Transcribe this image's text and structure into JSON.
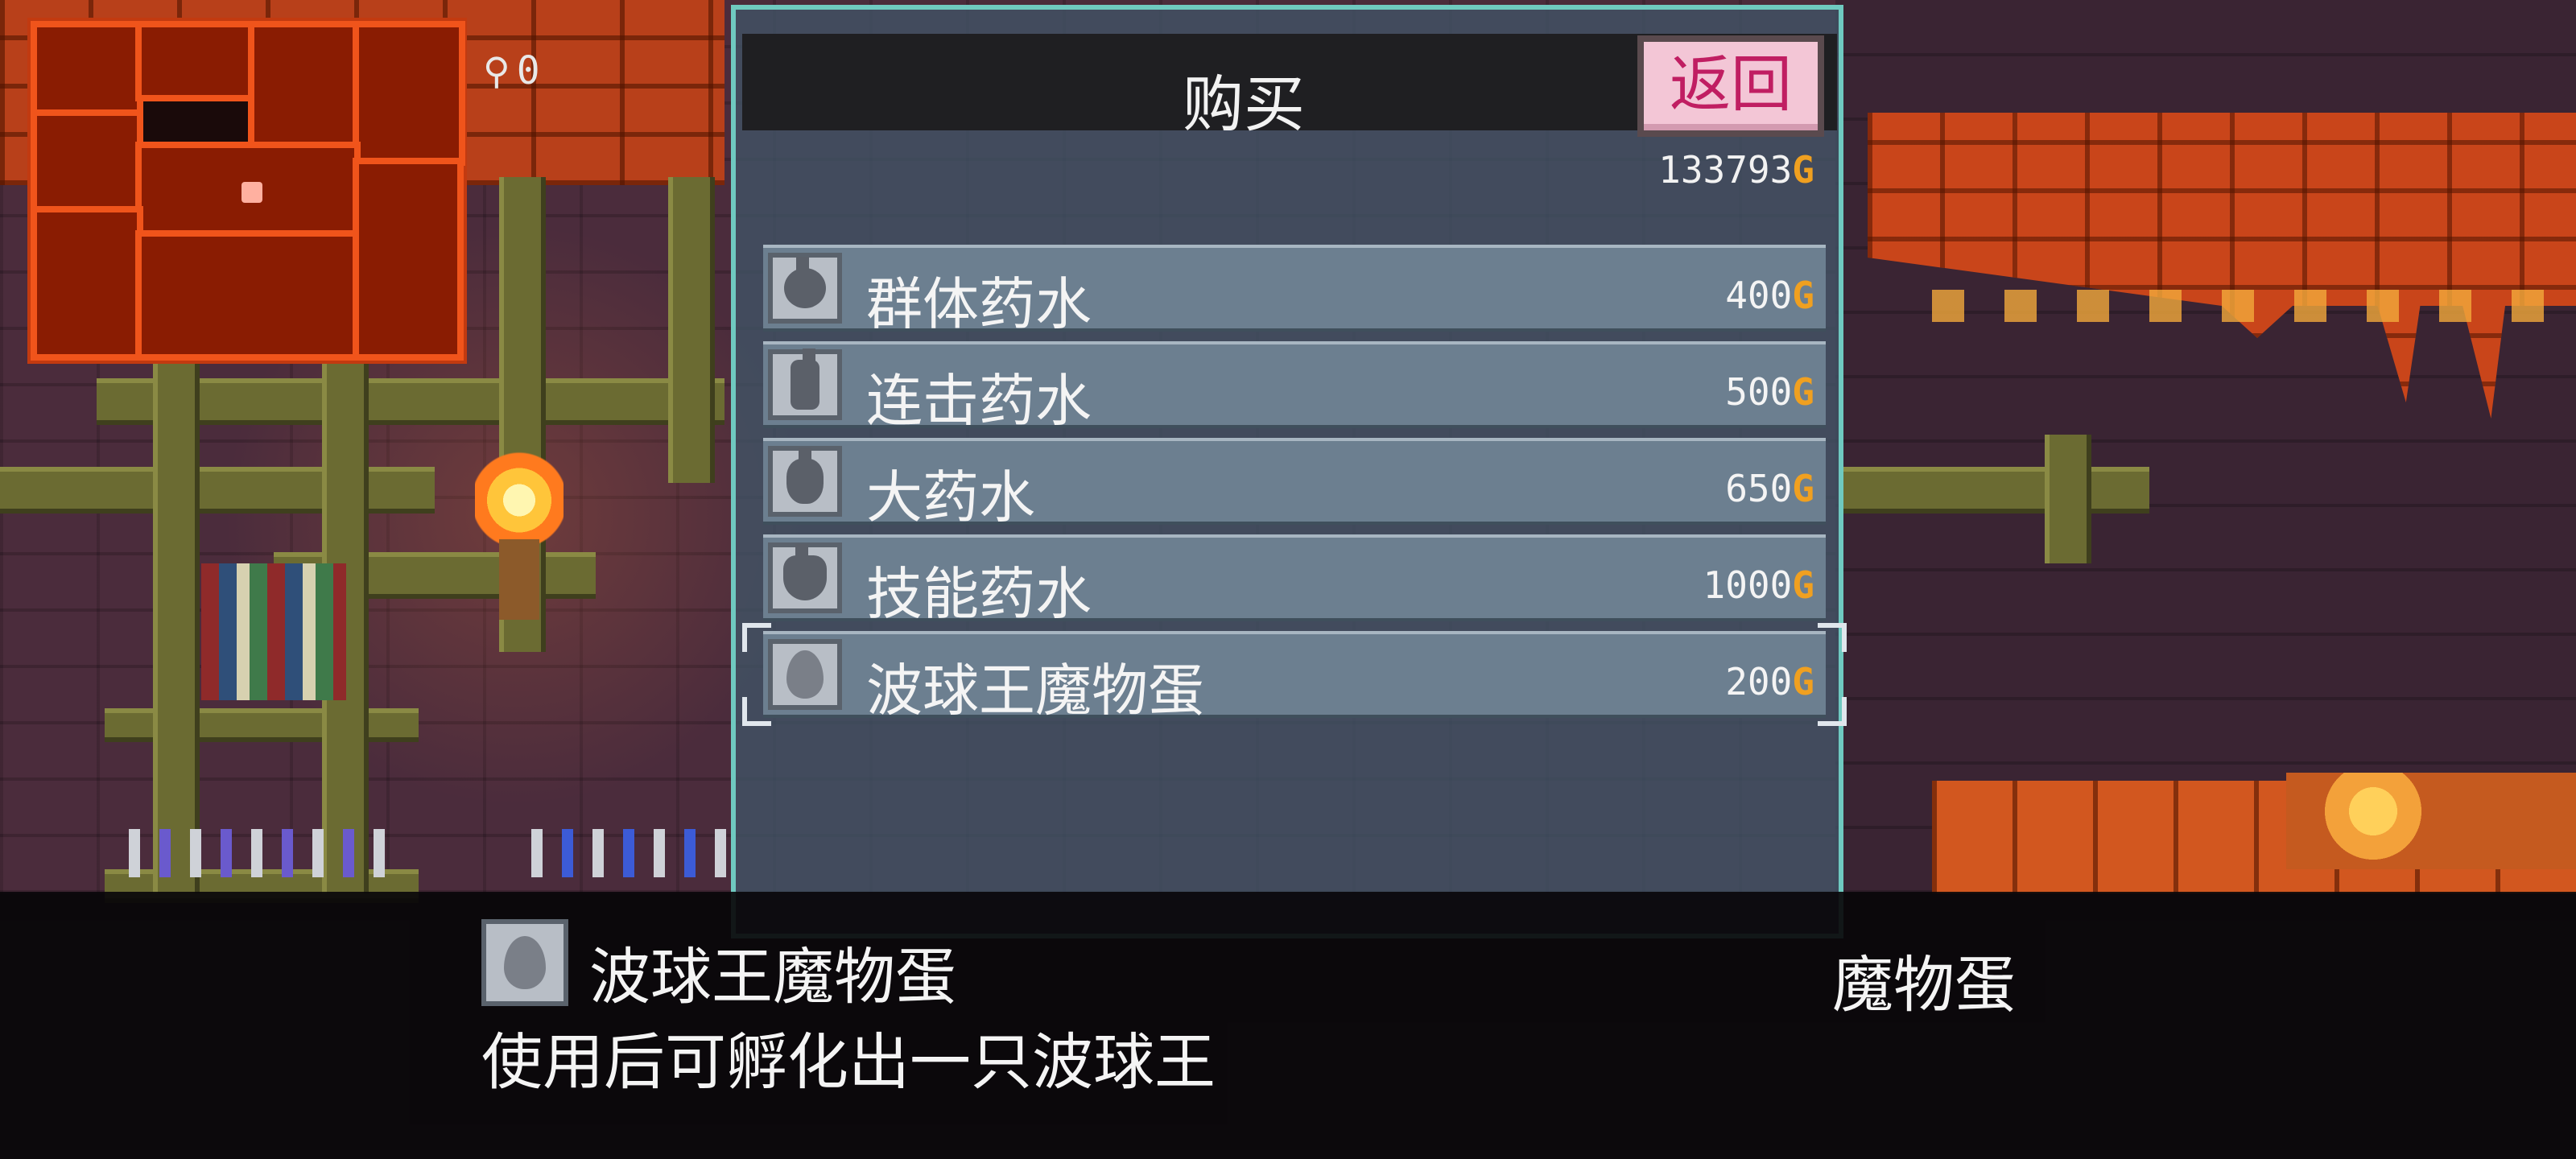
{
  "hud": {
    "key_count": "0"
  },
  "shop": {
    "title": "购买",
    "back_label": "返回",
    "gold_amount": "133793",
    "currency_symbol": "G",
    "items": [
      {
        "name": "群体药水",
        "price": "400",
        "icon": "potion-round-icon"
      },
      {
        "name": "连击药水",
        "price": "500",
        "icon": "potion-tall-icon"
      },
      {
        "name": "大药水",
        "price": "650",
        "icon": "potion-large-icon"
      },
      {
        "name": "技能药水",
        "price": "1000",
        "icon": "potion-skill-icon"
      },
      {
        "name": "波球王魔物蛋",
        "price": "200",
        "icon": "monster-egg-icon",
        "selected": true
      }
    ]
  },
  "description": {
    "item_name": "波球王魔物蛋",
    "text": "使用后可孵化出一只波球王",
    "category": "魔物蛋"
  },
  "colors": {
    "panel_border": "#6fc9c0",
    "back_button_bg": "#f3c6d6",
    "back_button_text": "#c01e62",
    "currency": "#f0a020",
    "minimap_wall": "#f0541b"
  }
}
